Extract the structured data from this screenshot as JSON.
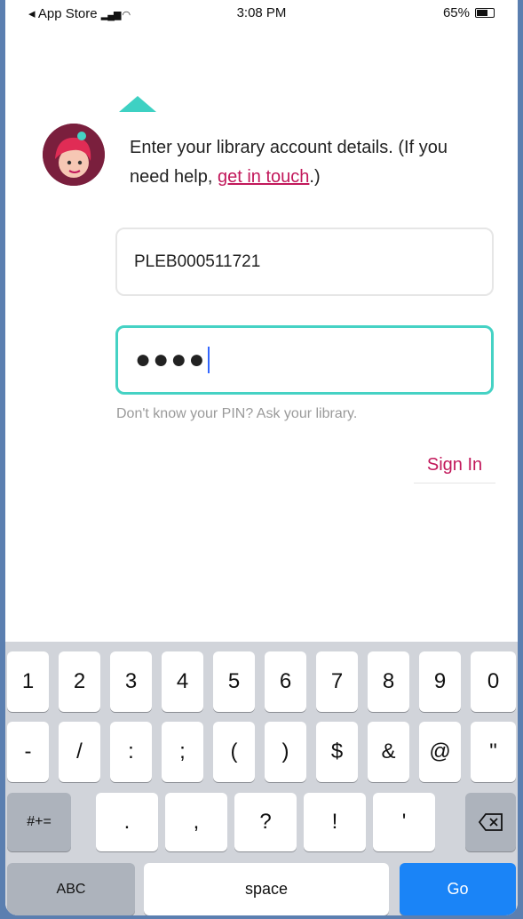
{
  "status_bar": {
    "back_app": "◂ App Store",
    "time": "3:08 PM",
    "battery": "65%"
  },
  "login": {
    "prompt_text": "Enter your library account details. (If you need help, ",
    "help_link": "get in touch",
    "prompt_end": ".)",
    "card_value": "PLEB000511721",
    "pin_value": "●●●●",
    "pin_hint": "Don't know your PIN? Ask your library.",
    "sign_in_label": "Sign In"
  },
  "keyboard": {
    "row1": [
      "1",
      "2",
      "3",
      "4",
      "5",
      "6",
      "7",
      "8",
      "9",
      "0"
    ],
    "row2": [
      "-",
      "/",
      ":",
      ";",
      "(",
      ")",
      "$",
      "&",
      "@",
      "\""
    ],
    "row3": {
      "shift": "#+=",
      "keys": [
        ".",
        ",",
        "?",
        "!",
        "'"
      ],
      "delete_icon": "backspace-icon"
    },
    "row4": {
      "abc": "ABC",
      "space": "space",
      "go": "Go"
    }
  },
  "colors": {
    "accent": "#c2185b",
    "teal": "#3ed1c3",
    "go_button": "#1a84f7"
  }
}
